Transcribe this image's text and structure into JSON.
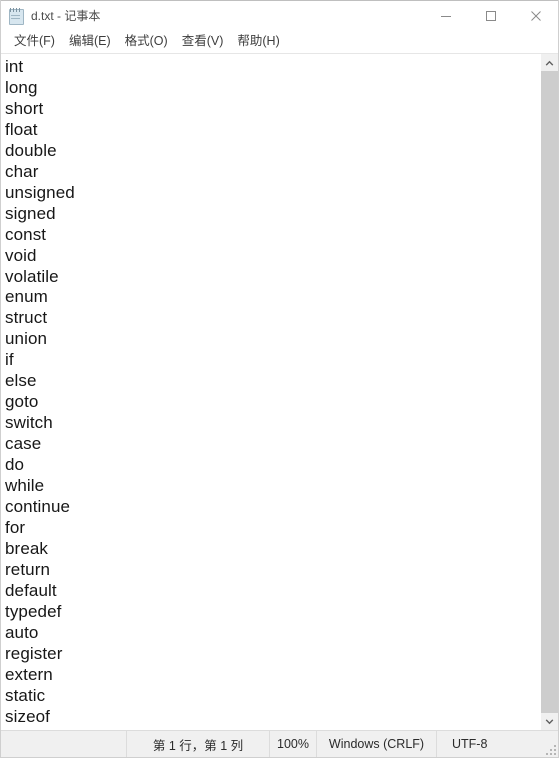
{
  "window": {
    "title": "d.txt - 记事本",
    "icon": "notepad-icon",
    "controls": {
      "minimize": "minimize-icon",
      "maximize": "maximize-icon",
      "close": "close-icon"
    }
  },
  "menubar": {
    "items": [
      {
        "label": "文件(F)"
      },
      {
        "label": "编辑(E)"
      },
      {
        "label": "格式(O)"
      },
      {
        "label": "查看(V)"
      },
      {
        "label": "帮助(H)"
      }
    ]
  },
  "editor": {
    "lines": [
      "int",
      "long",
      "short",
      "float",
      "double",
      "char",
      "unsigned",
      "signed",
      "const",
      "void",
      "volatile",
      "enum",
      "struct",
      "union",
      "if",
      "else",
      "goto",
      "switch",
      "case",
      "do",
      "while",
      "continue",
      "for",
      "break",
      "return",
      "default",
      "typedef",
      "auto",
      "register",
      "extern",
      "static",
      "sizeof"
    ]
  },
  "scrollbar": {
    "up_arrow": "chevron-up-icon",
    "down_arrow": "chevron-down-icon"
  },
  "statusbar": {
    "position": "第 1 行，第 1 列",
    "zoom": "100%",
    "line_ending": "Windows (CRLF)",
    "encoding": "UTF-8"
  },
  "colors": {
    "window_bg": "#ffffff",
    "chrome_bg": "#f0f0f0",
    "text": "#171717",
    "scrollbar_thumb": "#cdcdcd",
    "border": "#dcdcdc"
  }
}
